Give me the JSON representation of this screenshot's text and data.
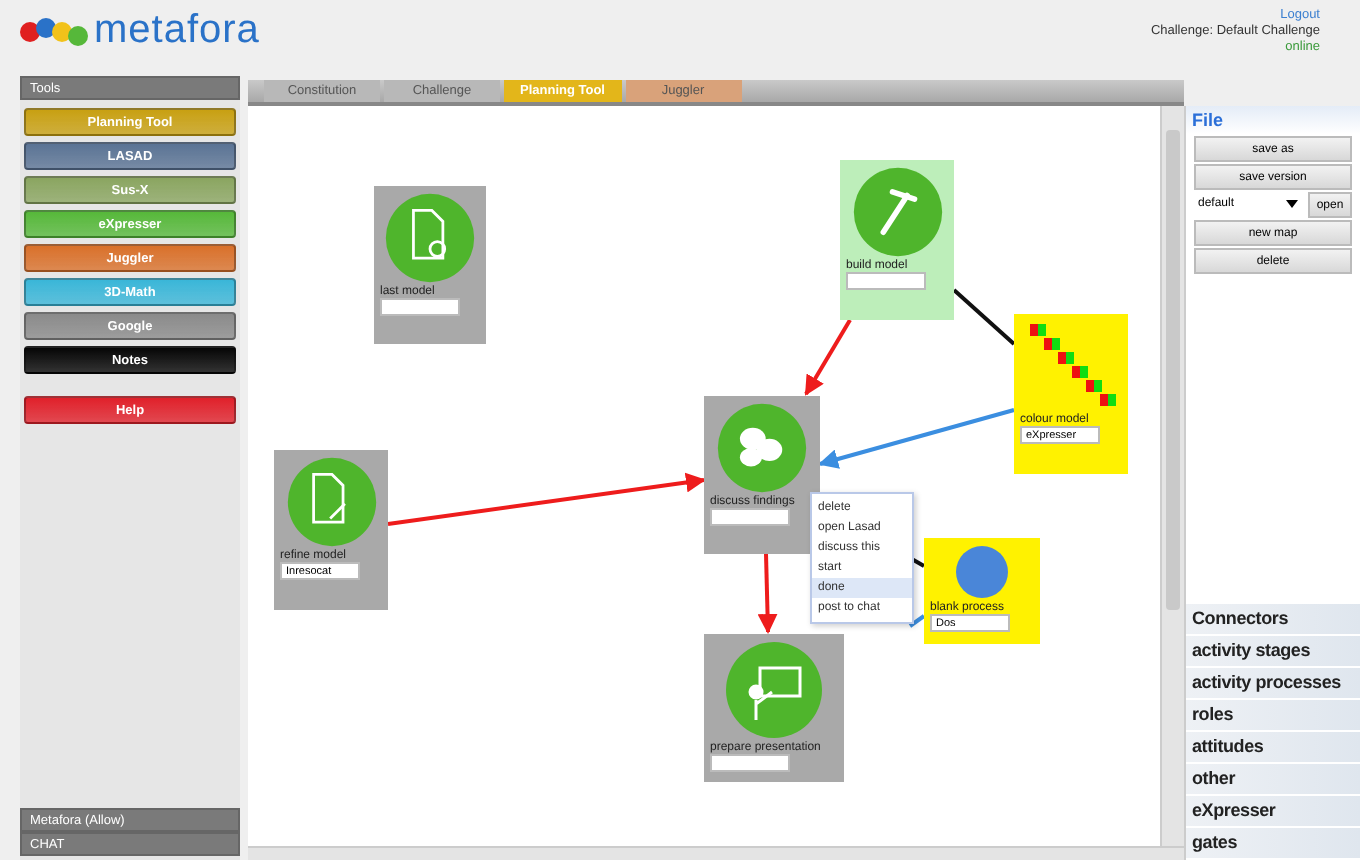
{
  "header": {
    "logo": "metafora",
    "logout": "Logout",
    "challenge": "Challenge: Default Challenge",
    "status": "online"
  },
  "sidebar": {
    "title": "Tools",
    "tools": [
      {
        "label": "Planning Tool",
        "color": "#c8a012"
      },
      {
        "label": "LASAD",
        "color": "#5a7394"
      },
      {
        "label": "Sus-X",
        "color": "#8aa560"
      },
      {
        "label": "eXpresser",
        "color": "#56b83a"
      },
      {
        "label": "Juggler",
        "color": "#d9702a"
      },
      {
        "label": "3D-Math",
        "color": "#3ab6d8"
      },
      {
        "label": "Google",
        "color": "#8a8a8a"
      },
      {
        "label": "Notes",
        "color": "#050505"
      },
      {
        "label": "Help",
        "color": "#e0202a"
      }
    ],
    "panels": [
      "Metafora (Allow)",
      "CHAT"
    ]
  },
  "tabs": [
    {
      "label": "Constitution",
      "selected": false,
      "color": "#b8b8b8"
    },
    {
      "label": "Challenge",
      "selected": false,
      "color": "#b8b8b8"
    },
    {
      "label": "Planning Tool",
      "selected": true,
      "color": "#e3b61a"
    },
    {
      "label": "Juggler",
      "selected": false,
      "color": "#d9a27a"
    }
  ],
  "nodes": [
    {
      "label": "last model",
      "color": "#a9a9a9"
    },
    {
      "label": "build model",
      "color": "#bdeeba"
    },
    {
      "label": "colour model",
      "value": "eXpresser",
      "color": "#fff200"
    },
    {
      "label": "discuss findings",
      "color": "#a9a9a9"
    },
    {
      "label": "refine model",
      "value": "Inresocat",
      "color": "#a9a9a9"
    },
    {
      "label": "blank process",
      "value": "Dos",
      "color": "#fff200"
    },
    {
      "label": "prepare presentation",
      "color": "#a9a9a9"
    }
  ],
  "edges": [
    {
      "color": "#ee1c1c"
    },
    {
      "color": "#3b8ee0"
    },
    {
      "color": "#ee1c1c"
    },
    {
      "color": "#ee1c1c"
    },
    {
      "color": "#111111"
    },
    {
      "color": "#111111"
    },
    {
      "color": "#3b8ee0"
    }
  ],
  "context_menu": [
    {
      "label": "delete",
      "selected": false
    },
    {
      "label": "open Lasad",
      "selected": false
    },
    {
      "label": "discuss this",
      "selected": false
    },
    {
      "label": "start",
      "selected": false
    },
    {
      "label": "done",
      "selected": true
    },
    {
      "label": "post to chat",
      "selected": false
    }
  ],
  "file_panel": {
    "title": "File",
    "buttons": [
      "save as",
      "save version"
    ],
    "select": "default",
    "open": "open",
    "buttons2": [
      "new map",
      "delete"
    ]
  },
  "categories": [
    "Connectors",
    "activity stages",
    "activity processes",
    "roles",
    "attitudes",
    "other",
    "eXpresser",
    "gates"
  ]
}
